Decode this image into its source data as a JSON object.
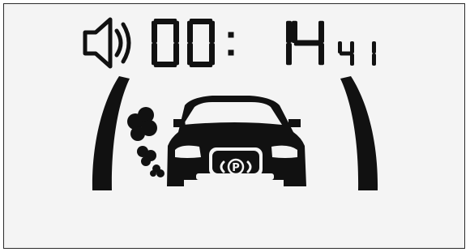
{
  "display": {
    "sound_icon": "speaker-sound-on-icon",
    "timer": {
      "main_digits": [
        "0",
        "0",
        "1",
        "4"
      ],
      "separator": ":",
      "small_digits": [
        "4",
        "1"
      ]
    },
    "scene": {
      "car_icon": "car-front-icon",
      "parking_brake_symbol": "P",
      "exhaust_icon": "exhaust-smoke-icon",
      "left_gauge": "left-arc-gauge",
      "right_gauge": "right-arc-gauge"
    },
    "colors": {
      "segment_on": "#111111",
      "background": "#f4f4f4",
      "border": "#2a2a2a"
    }
  }
}
